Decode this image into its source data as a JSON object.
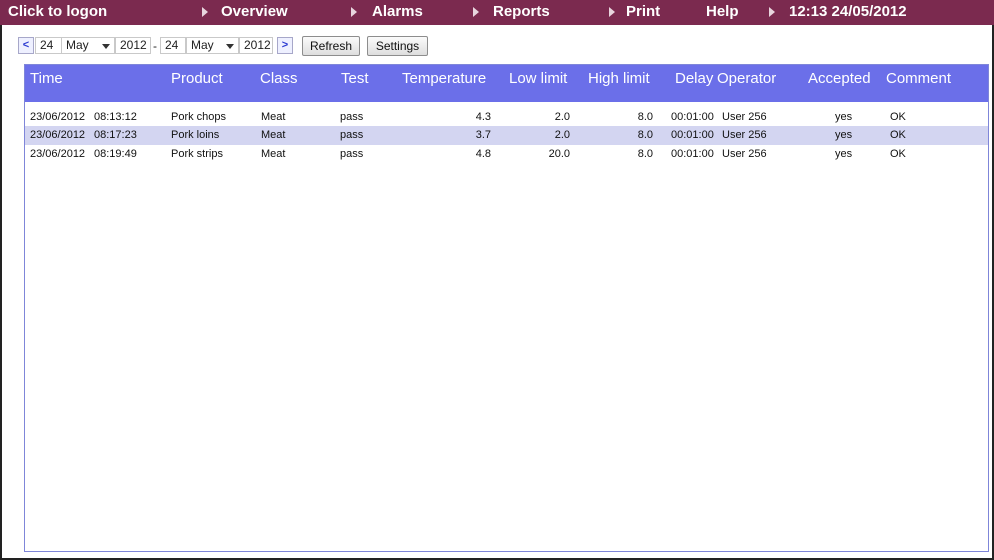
{
  "menu": {
    "logon": "Click to logon",
    "overview": "Overview",
    "alarms": "Alarms",
    "reports": "Reports",
    "print": "Print",
    "help": "Help",
    "clock": "12:13 24/05/2012"
  },
  "toolbar": {
    "prev": "<",
    "next": ">",
    "from_day": "24",
    "from_month": "May",
    "from_year": "2012",
    "separator": "-",
    "to_day": "24",
    "to_month": "May",
    "to_year": "2012",
    "refresh": "Refresh",
    "settings": "Settings"
  },
  "table": {
    "columns": [
      "Time",
      "Product",
      "Class",
      "Test",
      "Temperature",
      "Low limit",
      "High limit",
      "Delay",
      "Operator",
      "Accepted",
      "Comment"
    ],
    "rows": [
      {
        "date": "23/06/2012",
        "time": "08:13:12",
        "product": "Pork chops",
        "class": "Meat",
        "test": "pass",
        "temperature": "4.3",
        "low": "2.0",
        "high": "8.0",
        "delay": "00:01:00",
        "operator": "User 256",
        "accepted": "yes",
        "comment": "OK"
      },
      {
        "date": "23/06/2012",
        "time": "08:17:23",
        "product": "Pork loins",
        "class": "Meat",
        "test": "pass",
        "temperature": "3.7",
        "low": "2.0",
        "high": "8.0",
        "delay": "00:01:00",
        "operator": "User 256",
        "accepted": "yes",
        "comment": "OK"
      },
      {
        "date": "23/06/2012",
        "time": "08:19:49",
        "product": "Pork strips",
        "class": "Meat",
        "test": "pass",
        "temperature": "4.8",
        "low": "20.0",
        "high": "8.0",
        "delay": "00:01:00",
        "operator": "User 256",
        "accepted": "yes",
        "comment": "OK"
      }
    ]
  },
  "colors": {
    "menubar": "#7b2a4f",
    "header": "#6b6fe9",
    "row_highlight": "#d3d5f1"
  }
}
